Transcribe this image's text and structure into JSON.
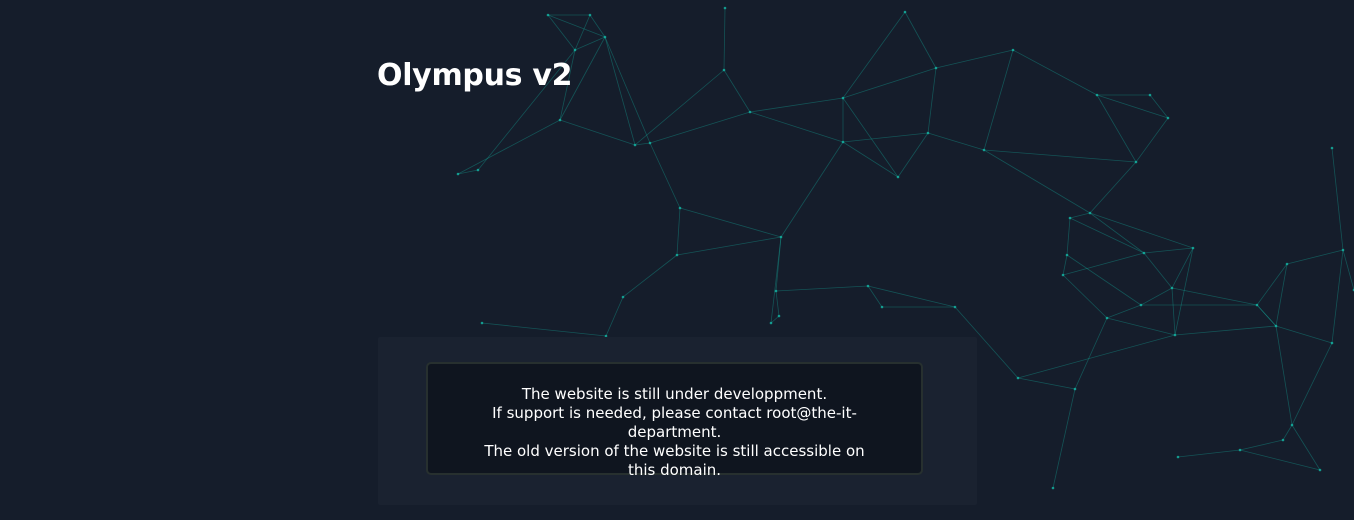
{
  "page": {
    "title": "Olympus v2"
  },
  "notice": {
    "line1": "The website is still under developpment.",
    "line2": "If support is needed, please contact root@the-it-department.",
    "line3": "The old version of the website is still accessible on this domain."
  },
  "theme": {
    "background": "#151d2b",
    "panel": "#1a2230",
    "notice_bg": "#0f151f",
    "notice_border": "#27302f",
    "network_accent": "#14b8a6"
  }
}
